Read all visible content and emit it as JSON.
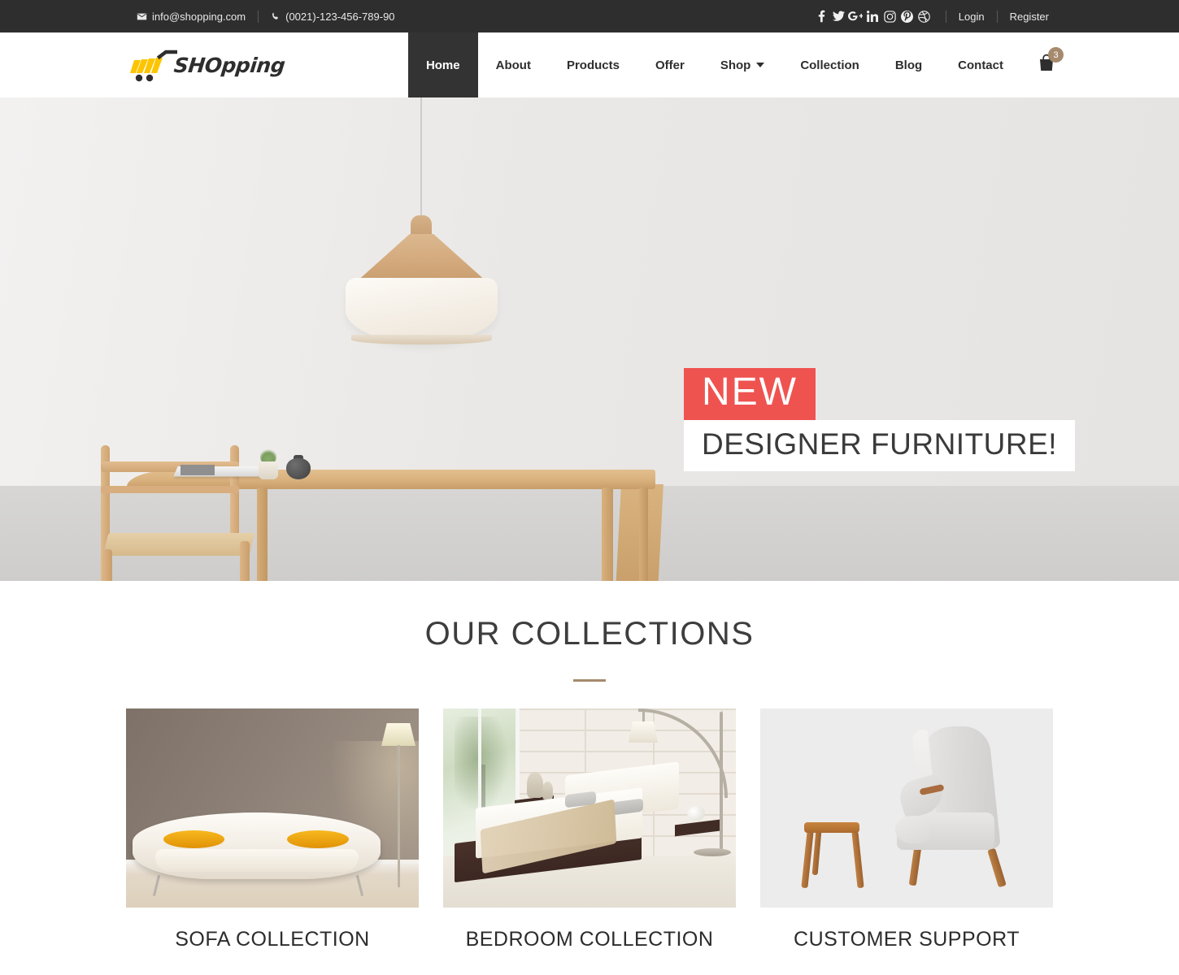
{
  "topbar": {
    "email": "info@shopping.com",
    "phone": "(0021)-123-456-789-90",
    "email_icon": "envelope-icon",
    "phone_icon": "phone-icon",
    "social": [
      {
        "name": "facebook-icon",
        "label": "f"
      },
      {
        "name": "twitter-icon",
        "label": "t"
      },
      {
        "name": "google-plus-icon",
        "label": "G+"
      },
      {
        "name": "linkedin-icon",
        "label": "in"
      },
      {
        "name": "instagram-icon",
        "label": "ig"
      },
      {
        "name": "pinterest-icon",
        "label": "p"
      },
      {
        "name": "dribbble-icon",
        "label": "d"
      }
    ],
    "login": "Login",
    "register": "Register",
    "background": "#2e2e2e"
  },
  "header": {
    "logo_text": "SHOpping",
    "logo_accent": "#fdc500",
    "logo_dark": "#2e2e2e",
    "nav": [
      {
        "label": "Home",
        "active": true,
        "dropdown": false
      },
      {
        "label": "About",
        "active": false,
        "dropdown": false
      },
      {
        "label": "Products",
        "active": false,
        "dropdown": false
      },
      {
        "label": "Offer",
        "active": false,
        "dropdown": false
      },
      {
        "label": "Shop",
        "active": false,
        "dropdown": true
      },
      {
        "label": "Collection",
        "active": false,
        "dropdown": false
      },
      {
        "label": "Blog",
        "active": false,
        "dropdown": false
      },
      {
        "label": "Contact",
        "active": false,
        "dropdown": false
      }
    ],
    "cart": {
      "icon": "shopping-bag-icon",
      "count": "3",
      "badge_color": "#a68a6d"
    },
    "active_bg": "#333333"
  },
  "hero": {
    "badge": "NEW",
    "headline": "DESIGNER FURNITURE!",
    "badge_color": "#ef5350",
    "headline_bg": "#ffffff",
    "headline_color": "#3a3a3a",
    "scene_alt": "Light oak dining table with chair, pendant lamp, magazine, potted plant and patterned vase in a minimal room"
  },
  "collections": {
    "title": "OUR COLLECTIONS",
    "divider_color": "#a68a6d",
    "items": [
      {
        "label": "SOFA COLLECTION",
        "image_alt": "White modern sofa with two orange bolster pillows against a taupe wall with floor lamp"
      },
      {
        "label": "BEDROOM COLLECTION",
        "image_alt": "Low platform bed with dark wood frame, white bedding, grey pillows and beige throw, white brick wall, arc floor lamp"
      },
      {
        "label": "CUSTOMER SUPPORT",
        "image_alt": "Grey upholstered lounge armchair with wooden legs next to a small wooden stool on a light grey background"
      }
    ]
  }
}
